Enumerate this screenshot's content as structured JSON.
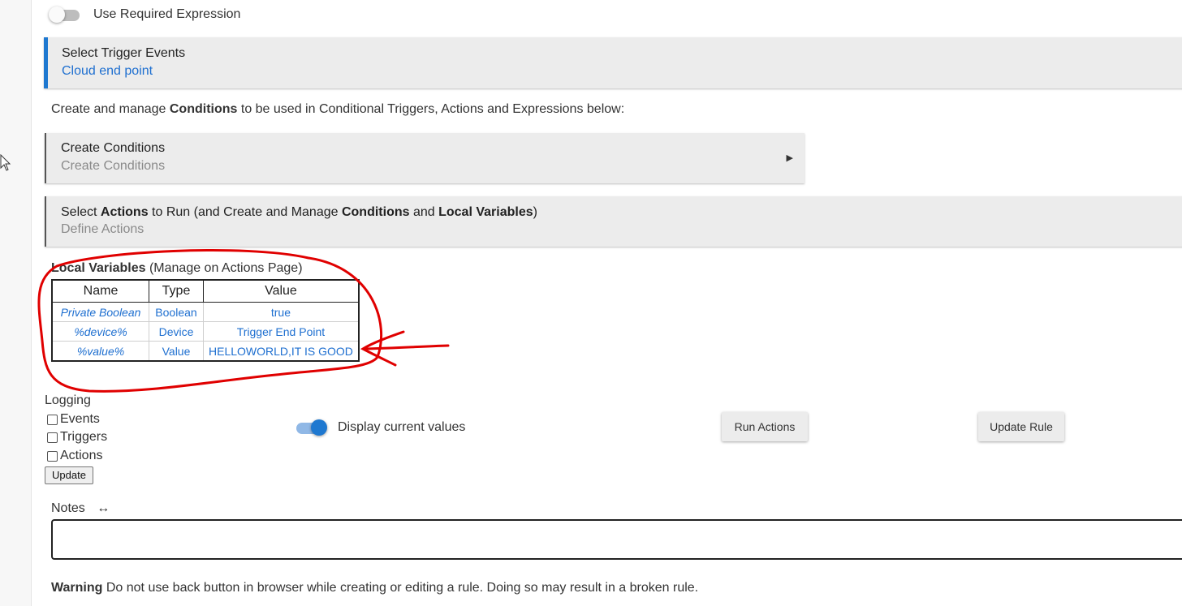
{
  "required_expression": {
    "label": "Use Required Expression",
    "enabled": false
  },
  "trigger_panel": {
    "title": "Select Trigger Events",
    "value": "Cloud end point"
  },
  "conditions_intro": {
    "prefix": "Create and manage ",
    "bold": "Conditions",
    "suffix": " to be used in Conditional Triggers, Actions and Expressions below:"
  },
  "conditions_panel": {
    "title": "Create Conditions",
    "subtitle": "Create Conditions"
  },
  "actions_panel": {
    "t1": "Select ",
    "b1": "Actions",
    "t2": " to Run (and Create and Manage ",
    "b2": "Conditions",
    "t3": " and ",
    "b3": "Local Variables",
    "t4": ")",
    "subtitle": "Define Actions"
  },
  "local_variables": {
    "heading_bold": "Local Variables",
    "heading_rest": " (Manage on Actions Page)",
    "columns": [
      "Name",
      "Type",
      "Value"
    ],
    "rows": [
      {
        "name": "Private Boolean",
        "type": "Boolean",
        "value": "true"
      },
      {
        "name": "%device%",
        "type": "Device",
        "value": "Trigger End Point"
      },
      {
        "name": "%value%",
        "type": "Value",
        "value": "HELLOWORLD,IT IS GOOD"
      }
    ]
  },
  "logging": {
    "title": "Logging",
    "options": [
      {
        "label": "Events",
        "checked": false
      },
      {
        "label": "Triggers",
        "checked": false
      },
      {
        "label": "Actions",
        "checked": false
      }
    ],
    "update_label": "Update"
  },
  "display_values": {
    "label": "Display current values",
    "enabled": true
  },
  "buttons": {
    "run_actions": "Run Actions",
    "update_rule": "Update Rule"
  },
  "notes": {
    "label": "Notes",
    "resize_glyph": "↔",
    "value": ""
  },
  "warning": {
    "bold": "Warning",
    "text": " Do not use back button in browser while creating or editing a rule. Doing so may result in a broken rule."
  },
  "colors": {
    "accent": "#1e78d0",
    "link": "#1e6fd0",
    "annotation": "#e00000"
  }
}
